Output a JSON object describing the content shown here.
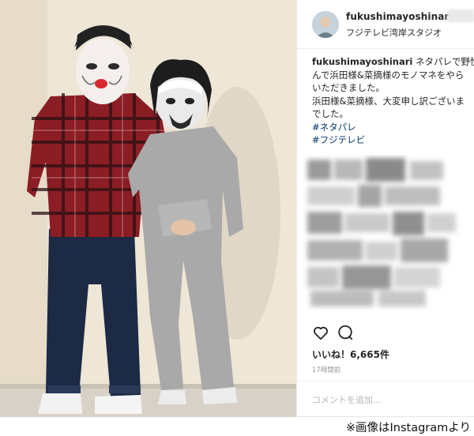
{
  "post": {
    "username": "fukushimayoshinari",
    "separator": "•",
    "location": "フジテレビ湾岸スタジオ",
    "caption": {
      "username": "fukushimayoshinari",
      "lines": [
        "ネタパレで野性爆",
        "んで浜田様&菜摘様のモノマネをやら",
        "いただきました。",
        "浜田様&菜摘様、大変申し訳ございま",
        "でした。"
      ],
      "hashtags": [
        "#ネタパレ",
        "#フジテレビ"
      ]
    },
    "likes_text": "いいね！6,665件",
    "time_text": "17時間前",
    "comment_placeholder": "コメントを追加...",
    "icons": {
      "like": "heart-icon",
      "comment": "comment-bubble-icon"
    }
  },
  "credit": "※画像はInstagramより"
}
